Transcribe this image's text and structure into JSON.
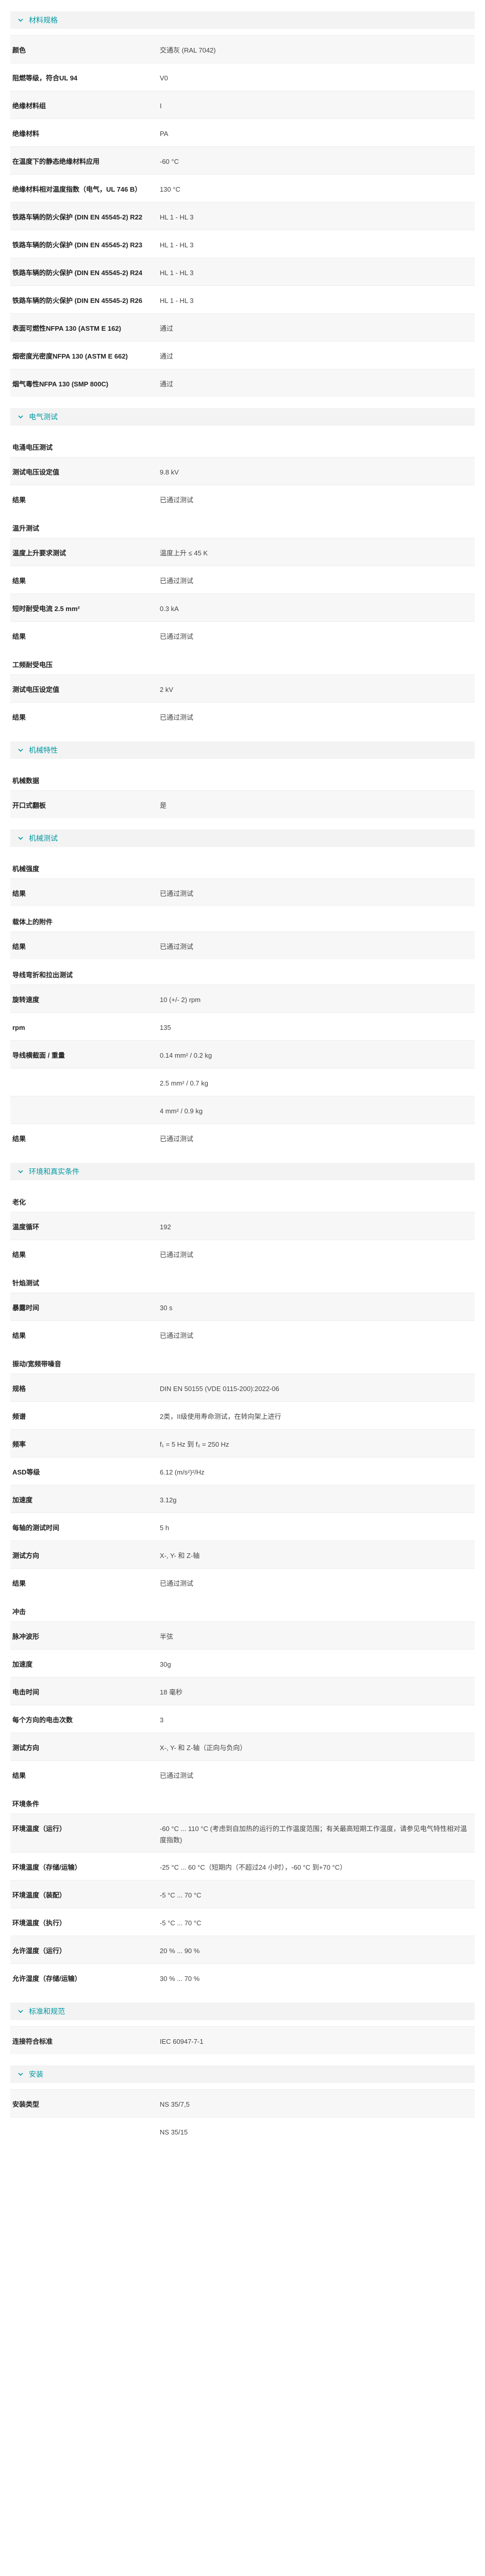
{
  "sections": [
    {
      "title": "材料规格",
      "groups": [
        {
          "title": "",
          "rows": [
            {
              "label": "颜色",
              "value": "交通灰 (RAL 7042)"
            },
            {
              "label": "阻燃等级，符合UL 94",
              "value": "V0"
            },
            {
              "label": "绝缘材料组",
              "value": "I"
            },
            {
              "label": "绝缘材料",
              "value": "PA"
            },
            {
              "label": "在温度下的静态绝缘材料应用",
              "value": "-60 °C"
            },
            {
              "label": "绝缘材料相对温度指数（电气，UL 746 B）",
              "value": "130 °C"
            },
            {
              "label": "铁路车辆的防火保护 (DIN EN 45545-2) R22",
              "value": "HL 1 - HL 3"
            },
            {
              "label": "铁路车辆的防火保护 (DIN EN 45545-2) R23",
              "value": "HL 1 - HL 3"
            },
            {
              "label": "铁路车辆的防火保护 (DIN EN 45545-2) R24",
              "value": "HL 1 - HL 3"
            },
            {
              "label": "铁路车辆的防火保护 (DIN EN 45545-2) R26",
              "value": "HL 1 - HL 3"
            },
            {
              "label": "表面可燃性NFPA 130 (ASTM E 162)",
              "value": "通过"
            },
            {
              "label": "烟密度光密度NFPA 130 (ASTM E 662)",
              "value": "通过"
            },
            {
              "label": "烟气毒性NFPA 130 (SMP 800C)",
              "value": "通过"
            }
          ]
        }
      ]
    },
    {
      "title": "电气测试",
      "groups": [
        {
          "title": "电涌电压测试",
          "rows": [
            {
              "label": "测试电压设定值",
              "value": "9.8 kV"
            },
            {
              "label": "结果",
              "value": "已通过测试"
            }
          ]
        },
        {
          "title": "温升测试",
          "rows": [
            {
              "label": "温度上升要求测试",
              "value": "温度上升 ≤ 45 K"
            },
            {
              "label": "结果",
              "value": "已通过测试"
            },
            {
              "label": "短时耐受电流 2.5 mm²",
              "value": "0.3 kA"
            },
            {
              "label": "结果",
              "value": "已通过测试"
            }
          ]
        },
        {
          "title": "工频耐受电压",
          "rows": [
            {
              "label": "测试电压设定值",
              "value": "2 kV"
            },
            {
              "label": "结果",
              "value": "已通过测试"
            }
          ]
        }
      ]
    },
    {
      "title": "机械特性",
      "groups": [
        {
          "title": "机械数据",
          "rows": [
            {
              "label": "开口式翻板",
              "value": "是"
            }
          ]
        }
      ]
    },
    {
      "title": "机械测试",
      "groups": [
        {
          "title": "机械强度",
          "rows": [
            {
              "label": "结果",
              "value": "已通过测试"
            }
          ]
        },
        {
          "title": "载体上的附件",
          "rows": [
            {
              "label": "结果",
              "value": "已通过测试"
            }
          ]
        },
        {
          "title": "导线弯折和拉出测试",
          "rows": [
            {
              "label": "旋转速度",
              "value": "10 (+/- 2) rpm"
            },
            {
              "label": "rpm",
              "value": "135"
            },
            {
              "label": "导线横截面 / 重量",
              "value": "0.14 mm² / 0.2 kg"
            },
            {
              "label": "",
              "value": "2.5 mm² / 0.7 kg"
            },
            {
              "label": "",
              "value": "4 mm² / 0.9 kg"
            },
            {
              "label": "结果",
              "value": "已通过测试"
            }
          ]
        }
      ]
    },
    {
      "title": "环境和真实条件",
      "groups": [
        {
          "title": "老化",
          "rows": [
            {
              "label": "温度循环",
              "value": "192"
            },
            {
              "label": "结果",
              "value": "已通过测试"
            }
          ]
        },
        {
          "title": "针焰测试",
          "rows": [
            {
              "label": "暴露时间",
              "value": "30 s"
            },
            {
              "label": "结果",
              "value": "已通过测试"
            }
          ]
        },
        {
          "title": "振动/宽频带噪音",
          "rows": [
            {
              "label": "规格",
              "value": "DIN EN 50155 (VDE 0115-200):2022-06"
            },
            {
              "label": "频谱",
              "value": "2类，II级使用寿命测试，在转向架上进行"
            },
            {
              "label": "频率",
              "value": "f₁ = 5 Hz 到 f₂ = 250 Hz"
            },
            {
              "label": "ASD等级",
              "value": "6.12 (m/s²)²/Hz"
            },
            {
              "label": "加速度",
              "value": "3.12g"
            },
            {
              "label": "每轴的测试时间",
              "value": "5 h"
            },
            {
              "label": "测试方向",
              "value": "X-, Y- 和 Z-轴"
            },
            {
              "label": "结果",
              "value": "已通过测试"
            }
          ]
        },
        {
          "title": "冲击",
          "rows": [
            {
              "label": "脉冲波形",
              "value": "半弦"
            },
            {
              "label": "加速度",
              "value": "30g"
            },
            {
              "label": "电击时间",
              "value": "18 毫秒"
            },
            {
              "label": "每个方向的电击次数",
              "value": "3"
            },
            {
              "label": "测试方向",
              "value": "X-, Y- 和 Z-轴（正向与负向）"
            },
            {
              "label": "结果",
              "value": "已通过测试"
            }
          ]
        },
        {
          "title": "环境条件",
          "rows": [
            {
              "label": "环境温度（运行）",
              "value": "-60 °C ... 110 °C (考虑到自加热的运行的工作温度范围；有关最高短期工作温度，请参见电气特性相对温度指数)"
            },
            {
              "label": "环境温度（存储/运输）",
              "value": "-25 °C ... 60 °C（短期内（不超过24 小时），-60 °C 到+70 °C）"
            },
            {
              "label": "环境温度（装配）",
              "value": "-5 °C ... 70 °C"
            },
            {
              "label": "环境温度（执行）",
              "value": "-5 °C ... 70 °C"
            },
            {
              "label": "允许湿度（运行）",
              "value": "20 % ... 90 %"
            },
            {
              "label": "允许湿度（存储/运输）",
              "value": "30 % ... 70 %"
            }
          ]
        }
      ]
    },
    {
      "title": "标准和规范",
      "groups": [
        {
          "title": "",
          "rows": [
            {
              "label": "连接符合标准",
              "value": "IEC 60947-7-1"
            }
          ]
        }
      ]
    },
    {
      "title": "安装",
      "groups": [
        {
          "title": "",
          "rows": [
            {
              "label": "安装类型",
              "value": "NS 35/7,5"
            },
            {
              "label": "",
              "value": "NS 35/15"
            }
          ]
        }
      ]
    }
  ]
}
